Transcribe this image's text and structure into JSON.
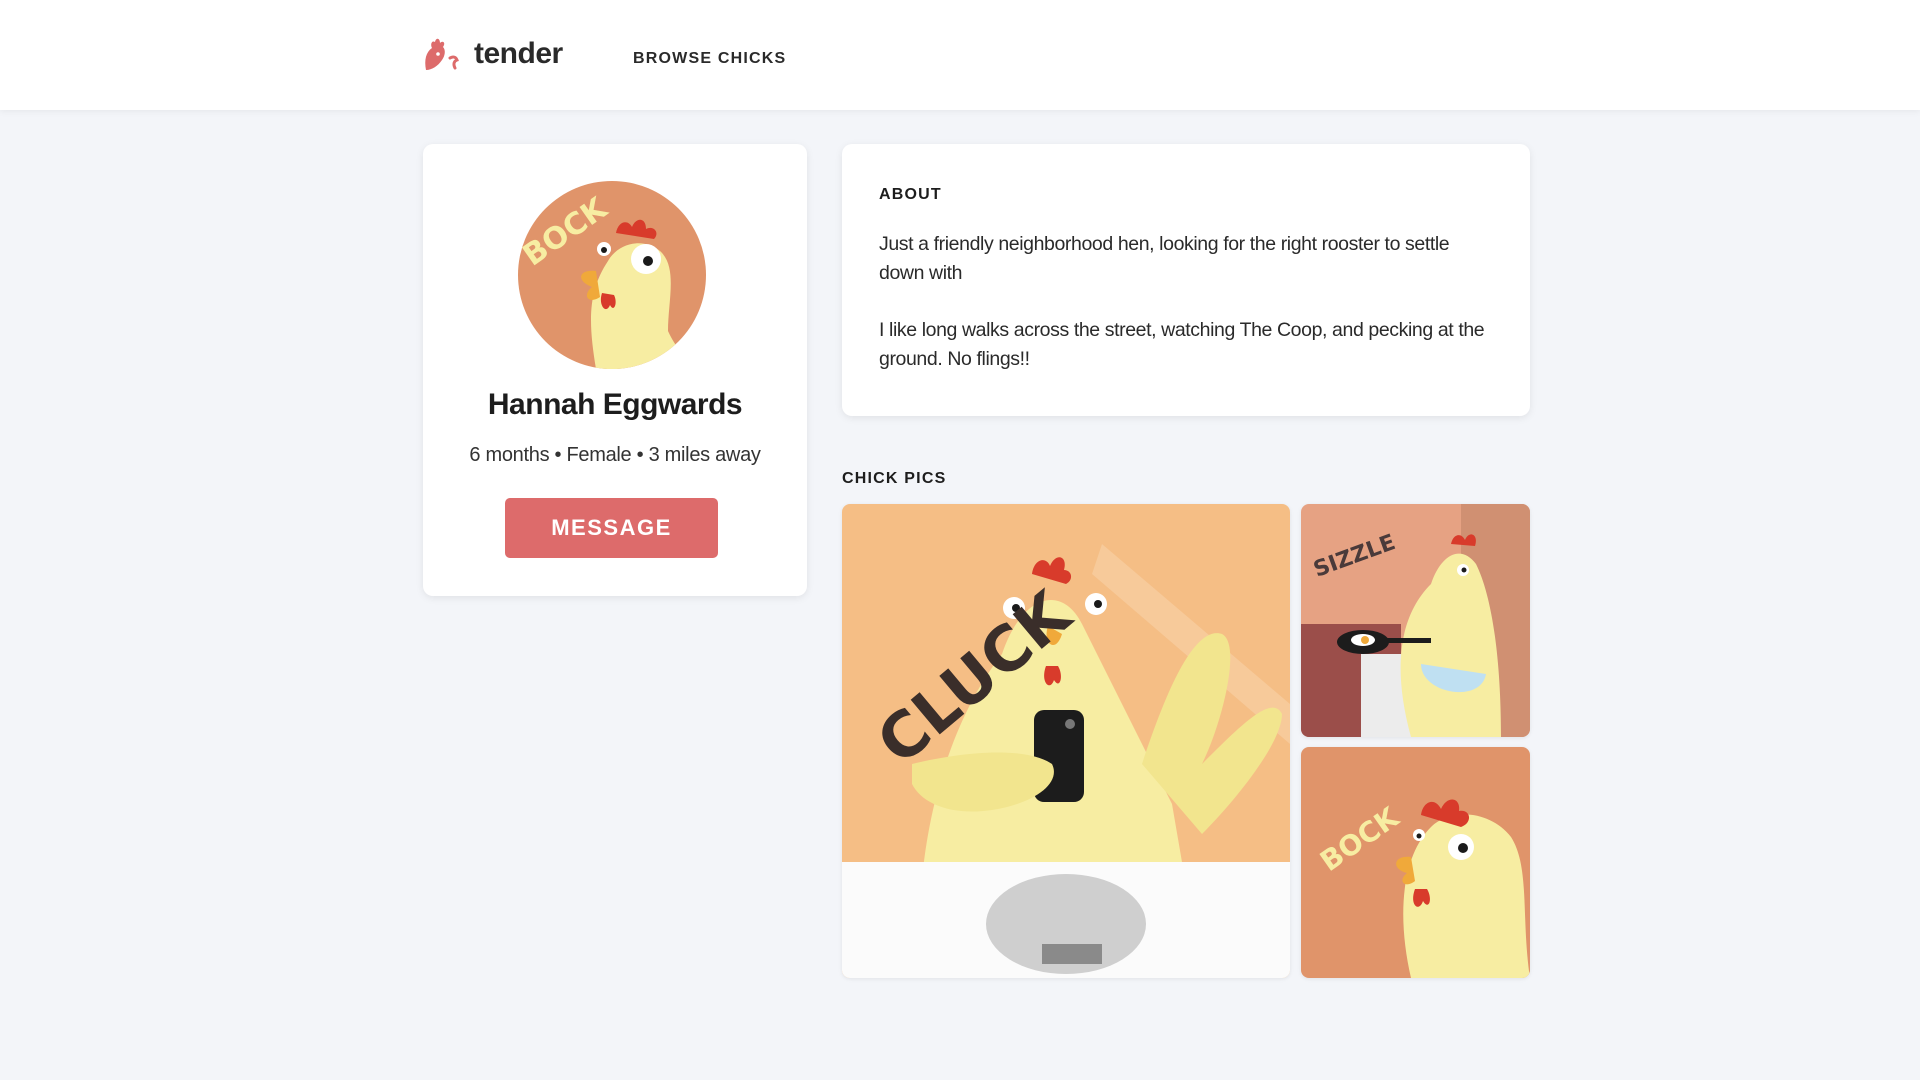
{
  "header": {
    "logo_text": "tender",
    "nav_browse": "BROWSE CHICKS"
  },
  "profile": {
    "name": "Hannah Eggwards",
    "meta": "6 months • Female • 3 miles away",
    "message_button": "MESSAGE",
    "avatar_text": "BOCK"
  },
  "about": {
    "heading": "ABOUT",
    "paragraph1": "Just a friendly neighborhood hen, looking for the right rooster to settle down with",
    "paragraph2": "I like long walks across the street, watching The Coop, and pecking at the ground. No flings!!"
  },
  "pics": {
    "heading": "CHICK PICS",
    "large_text": "CLUCK",
    "small1_text": "SIZZLE",
    "small2_text": "BOCK"
  },
  "colors": {
    "accent": "#dd6b6b",
    "background": "#f3f5f9",
    "card": "#ffffff",
    "peach": "#f5be85",
    "terracotta": "#e0946a",
    "chick_yellow": "#f7eda2",
    "comb_red": "#d83b2b"
  }
}
